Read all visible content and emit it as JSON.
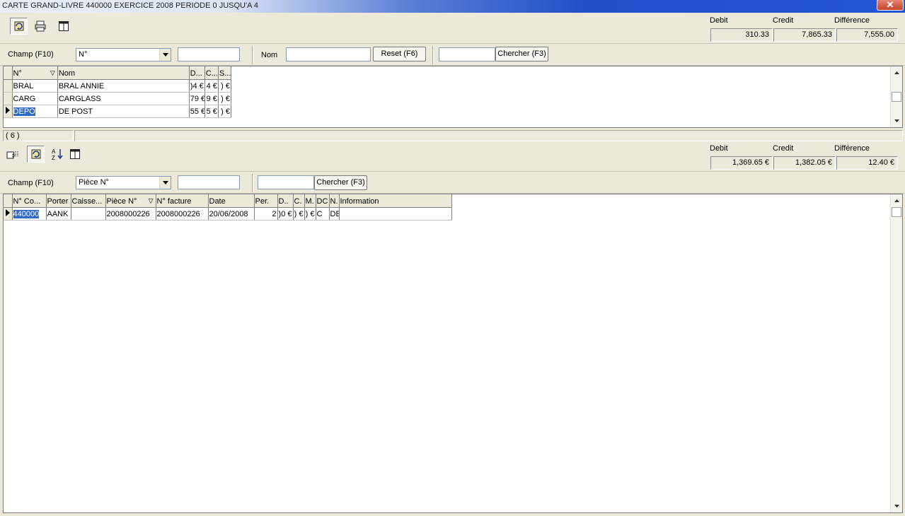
{
  "window": {
    "title": "CARTE GRAND-LIVRE 440000 EXERCICE 2008 PERIODE 0 JUSQU'A 4",
    "close_glyph": "✕"
  },
  "top": {
    "totals": {
      "debit_label": "Debit",
      "credit_label": "Credit",
      "diff_label": "Différence",
      "debit": "310.33",
      "credit": "7,865.33",
      "diff": "7,555.00"
    },
    "search": {
      "field_label": "Champ (F10)",
      "field_value": "N°",
      "name_label": "Nom",
      "reset_label": "Reset (F6)",
      "search_label": "Chercher (F3)"
    },
    "grid": {
      "headers": [
        "N°",
        "Nom",
        "D...",
        "C...",
        "S..."
      ],
      "rows": [
        [
          "BRAL",
          "BRAL ANNIE",
          ")4 €",
          "4 €",
          ") €"
        ],
        [
          "CARG",
          "CARGLASS",
          "79 €",
          "9 €",
          ") €"
        ],
        [
          "DEPO",
          "DE POST",
          "55 €",
          "5 €",
          ") €"
        ]
      ]
    },
    "status_count": "( 6 )"
  },
  "bottom": {
    "totals": {
      "debit_label": "Debit",
      "credit_label": "Credit",
      "diff_label": "Différence",
      "debit": "1,369.65 €",
      "credit": "1,382.05 €",
      "diff": "12.40 €"
    },
    "search": {
      "field_label": "Champ (F10)",
      "field_value": "Pièce N°",
      "search_label": "Chercher (F3)"
    },
    "grid": {
      "headers": [
        "N° Co...",
        "Porter",
        "Caisse...",
        "Pièce N°",
        "N° facture",
        "Date",
        "Per.",
        "D..",
        "C.",
        "M.",
        "DC",
        "N.",
        "Information"
      ],
      "rows": [
        [
          "440000",
          "AANK",
          "",
          "2008000226",
          "2008000226",
          "20/06/2008",
          "2",
          ")0 €",
          ") €",
          ") €",
          "C",
          "DE",
          ""
        ]
      ]
    }
  }
}
